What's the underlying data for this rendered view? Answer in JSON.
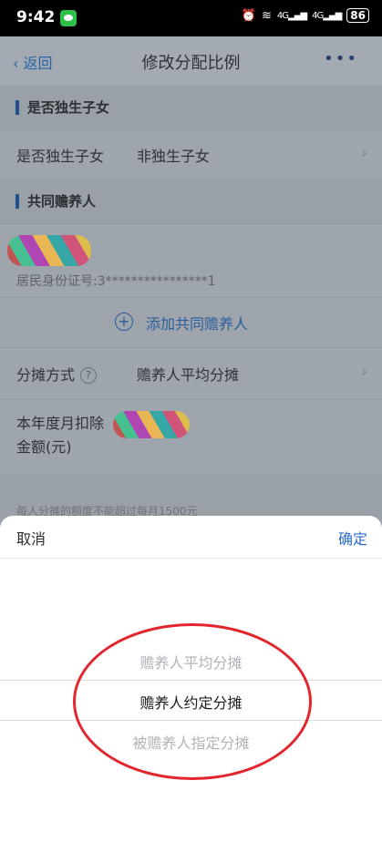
{
  "status": {
    "time": "9:42",
    "battery": "86",
    "network": "4G"
  },
  "nav": {
    "back_label": "返回",
    "title": "修改分配比例",
    "more": "•••"
  },
  "section1": {
    "header": "是否独生子女",
    "row_label": "是否独生子女",
    "row_value": "非独生子女"
  },
  "section2": {
    "header": "共同赡养人",
    "id_text": "居民身份证号:3****************1",
    "add_label": "添加共同赡养人"
  },
  "split": {
    "label": "分摊方式",
    "value": "赡养人平均分摊"
  },
  "monthly": {
    "label_line1": "本年度月扣除",
    "label_line2": "金额(元)"
  },
  "partial_note": "每人分摊的额度不能超过每月1500元",
  "sheet": {
    "cancel": "取消",
    "confirm": "确定",
    "options": [
      "赡养人平均分摊",
      "赡养人约定分摊",
      "被赡养人指定分摊"
    ]
  },
  "colors": {
    "accent": "#2b6cc4",
    "annotation": "#e3252e"
  }
}
